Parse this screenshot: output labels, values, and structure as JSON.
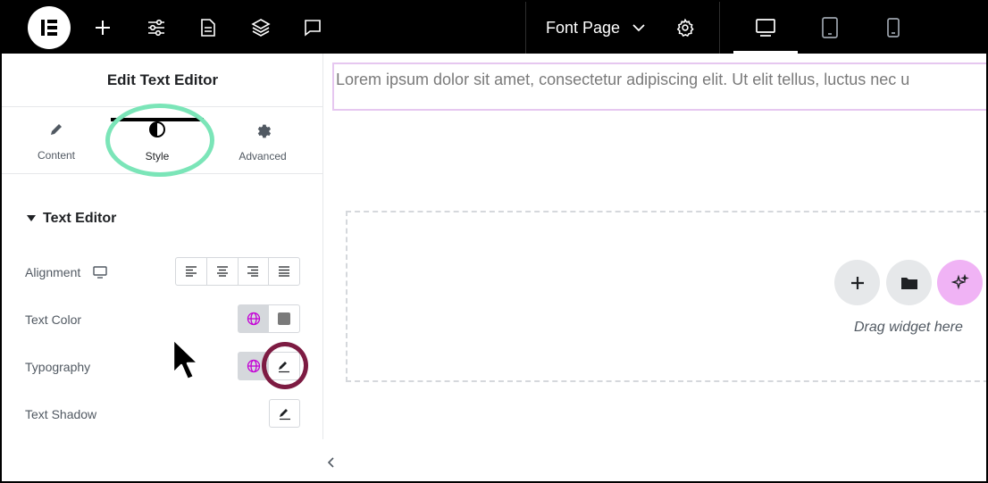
{
  "topbar": {
    "logo_icon": "elementor-logo-icon",
    "page_name": "Font Page",
    "icons": [
      "plus-icon",
      "sliders-icon",
      "document-icon",
      "layers-icon",
      "comment-icon",
      "gear-icon",
      "desktop-icon",
      "tablet-icon",
      "mobile-icon"
    ]
  },
  "panel": {
    "title": "Edit Text Editor",
    "tabs": [
      {
        "label": "Content",
        "icon": "pencil-icon"
      },
      {
        "label": "Style",
        "icon": "half-circle-icon"
      },
      {
        "label": "Advanced",
        "icon": "gear-icon"
      }
    ],
    "section_title": "Text Editor",
    "rows": {
      "alignment": "Alignment",
      "text_color": "Text Color",
      "typography": "Typography",
      "text_shadow": "Text Shadow"
    }
  },
  "canvas": {
    "text_content": "Lorem ipsum dolor sit amet, consectetur adipiscing elit. Ut elit tellus, luctus nec u",
    "drag_hint": "Drag widget here"
  },
  "colors": {
    "topbar_bg": "#000000",
    "highlight_green": "#7be5b8",
    "highlight_maroon": "#7d1b42",
    "ai_button": "#f0b3f5",
    "global_pink": "#c400d6"
  }
}
